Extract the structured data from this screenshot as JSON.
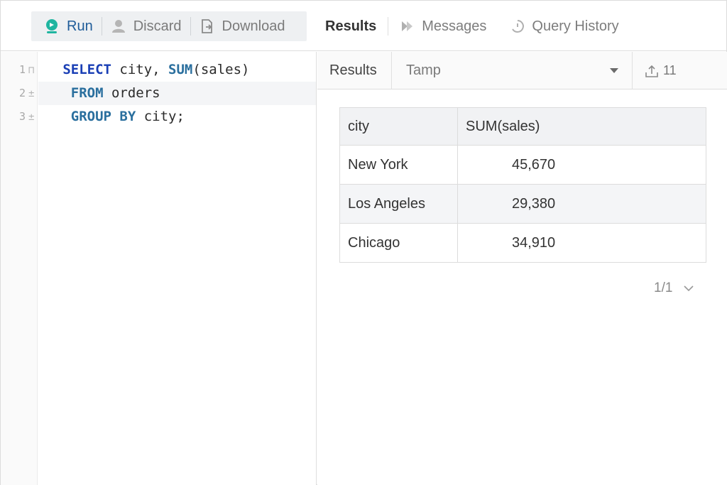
{
  "toolbar": {
    "run_label": "Run",
    "discard_label": "Discard",
    "download_label": "Download"
  },
  "tabs": [
    {
      "label": "Results",
      "active": true
    },
    {
      "label": "Messages",
      "active": false
    },
    {
      "label": "Query History",
      "active": false
    }
  ],
  "editor": {
    "line_numbers": [
      "1",
      "2",
      "3"
    ],
    "gutter_marks": [
      "⊓",
      "±",
      "±"
    ],
    "lines": [
      {
        "k1": "SELECT",
        "t1": " city, ",
        "k2": "SUM",
        "t2": "(sales)"
      },
      {
        "k1": "FROM",
        "t1": " orders"
      },
      {
        "k1": "GROUP BY",
        "t1": " city;"
      }
    ]
  },
  "results_bar": {
    "label": "Results",
    "selected": "Tamp",
    "count": "11"
  },
  "table": {
    "columns": [
      "city",
      "SUM(sales)"
    ],
    "rows": [
      [
        "New York",
        "45,670"
      ],
      [
        "Los Angeles",
        "29,380"
      ],
      [
        "Chicago",
        "34,910"
      ]
    ]
  },
  "pager": {
    "text": "1/1"
  },
  "colors": {
    "run_icon": "#1fb5a0",
    "run_text": "#1f5c99",
    "keyword": "#1a3fb5",
    "keyword_alt": "#2a6f9e"
  }
}
